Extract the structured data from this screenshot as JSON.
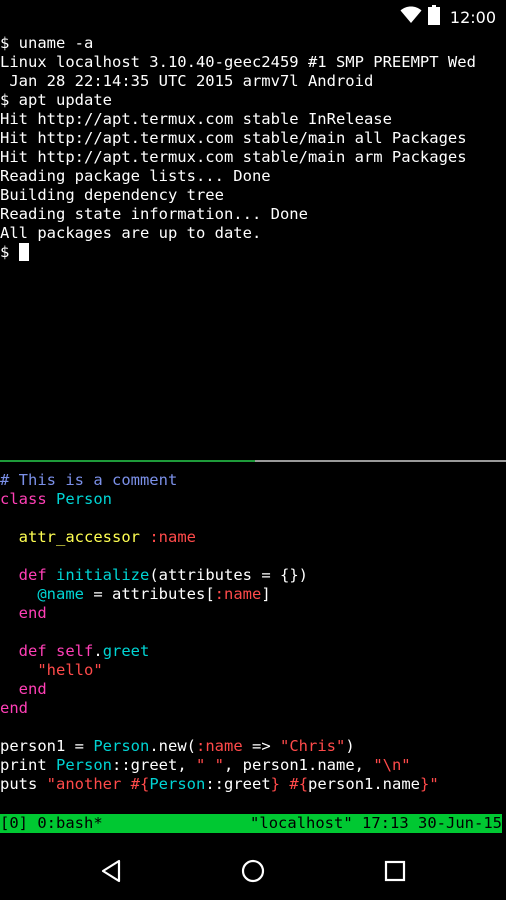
{
  "status_bar": {
    "time": "12:00",
    "icons": [
      "wifi-icon",
      "battery-icon"
    ]
  },
  "terminal_top": {
    "lines": [
      "$ uname -a",
      "Linux localhost 3.10.40-geec2459 #1 SMP PREEMPT Wed",
      " Jan 28 22:14:35 UTC 2015 armv7l Android",
      "$ apt update",
      "Hit http://apt.termux.com stable InRelease",
      "Hit http://apt.termux.com stable/main all Packages",
      "Hit http://apt.termux.com stable/main arm Packages",
      "Reading package lists... Done",
      "Building dependency tree",
      "Reading state information... Done",
      "All packages are up to date."
    ],
    "prompt": "$ "
  },
  "code": {
    "comment": "# This is a comment",
    "kw_class": "class",
    "class_name": "Person",
    "attr_accessor": "attr_accessor",
    "sym_name": ":name",
    "kw_def": "def",
    "initialize": "initialize",
    "init_args": "(attributes = {})",
    "ivar_name": "@name",
    "assign_attr": " = attributes[",
    "close_bracket": "]",
    "kw_end": "end",
    "kw_self": "self",
    "dot": ".",
    "greet": "greet",
    "hello": "\"hello\"",
    "person1_assign": "person1 = ",
    "new_open": ".new(",
    "arrow": " => ",
    "chris": "\"Chris\"",
    "close_paren": ")",
    "print_kw": "print ",
    "scope_greet": "::greet, ",
    "space_str": "\" \"",
    "person1_name": ", person1.name, ",
    "newline_str": "\"\\n\"",
    "puts_kw": "puts ",
    "another": "\"another ",
    "interp_open": "#{",
    "interp_close": "}",
    "person1_name_plain": "person1.name",
    "quote_close": "\"",
    "space": " "
  },
  "tmux": {
    "left": "[0] 0:bash*",
    "right": "\"localhost\" 17:13 30-Jun-15"
  },
  "nav": {
    "buttons": [
      "back",
      "home",
      "recents"
    ]
  },
  "colors": {
    "tmux_bar": "#00c832",
    "comment": "#7b90e8",
    "keyword": "#ff3fb6",
    "class": "#00d4d4",
    "method": "#ffff52",
    "string": "#ff4a4a"
  }
}
